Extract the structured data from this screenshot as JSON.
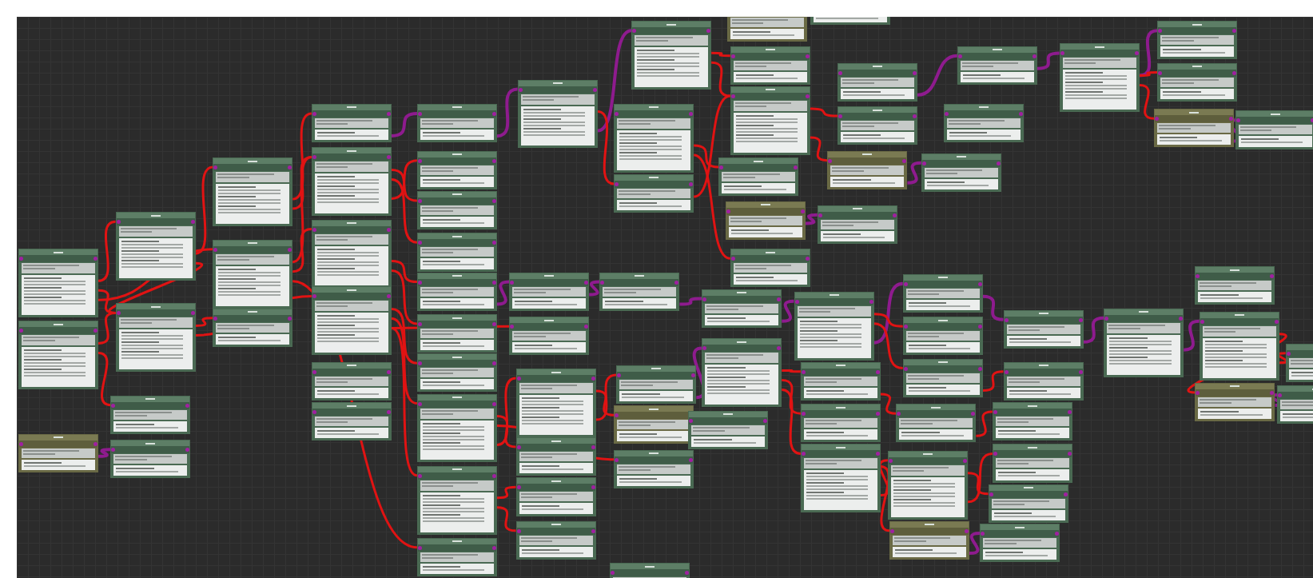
{
  "canvas": {
    "nodes": [
      {
        "kind": "chat",
        "expanded": true
      },
      {
        "kind": "chat",
        "expanded": true
      },
      {
        "kind": "event",
        "expanded": false
      },
      {
        "kind": "chat",
        "expanded": true
      },
      {
        "kind": "chat",
        "expanded": true
      },
      {
        "kind": "chat",
        "expanded": false
      },
      {
        "kind": "chat",
        "expanded": false
      },
      {
        "kind": "chat",
        "expanded": true
      },
      {
        "kind": "chat",
        "expanded": true
      },
      {
        "kind": "chat",
        "expanded": false
      },
      {
        "kind": "chat",
        "expanded": false
      },
      {
        "kind": "chat",
        "expanded": true
      },
      {
        "kind": "chat",
        "expanded": true
      },
      {
        "kind": "chat",
        "expanded": true
      },
      {
        "kind": "chat",
        "expanded": false
      },
      {
        "kind": "chat",
        "expanded": false
      },
      {
        "kind": "chat",
        "expanded": false
      },
      {
        "kind": "chat",
        "expanded": false
      },
      {
        "kind": "chat",
        "expanded": false
      },
      {
        "kind": "chat",
        "expanded": false
      },
      {
        "kind": "chat",
        "expanded": false
      },
      {
        "kind": "chat",
        "expanded": false
      },
      {
        "kind": "chat",
        "expanded": false
      },
      {
        "kind": "chat",
        "expanded": true
      },
      {
        "kind": "chat",
        "expanded": true
      },
      {
        "kind": "chat",
        "expanded": false
      },
      {
        "kind": "chat",
        "expanded": true
      },
      {
        "kind": "chat",
        "expanded": false
      },
      {
        "kind": "chat",
        "expanded": false
      },
      {
        "kind": "chat",
        "expanded": true
      },
      {
        "kind": "chat",
        "expanded": false
      },
      {
        "kind": "chat",
        "expanded": false
      },
      {
        "kind": "chat",
        "expanded": false
      },
      {
        "kind": "chat",
        "expanded": false
      },
      {
        "kind": "chat",
        "expanded": true
      },
      {
        "kind": "chat",
        "expanded": false
      },
      {
        "kind": "chat",
        "expanded": false
      },
      {
        "kind": "event",
        "expanded": false
      },
      {
        "kind": "chat",
        "expanded": false
      },
      {
        "kind": "chat"
      },
      {
        "kind": "chat",
        "expanded": true
      },
      {
        "kind": "chat",
        "expanded": false
      },
      {
        "kind": "chat",
        "expanded": true
      },
      {
        "kind": "chat",
        "expanded": false
      },
      {
        "kind": "event",
        "expanded": false
      },
      {
        "kind": "chat",
        "expanded": false
      },
      {
        "kind": "chat",
        "expanded": true
      },
      {
        "kind": "chat",
        "expanded": false
      },
      {
        "kind": "event",
        "expanded": false
      },
      {
        "kind": "chat",
        "expanded": false
      },
      {
        "kind": "chat",
        "expanded": false
      },
      {
        "kind": "chat",
        "expanded": false
      },
      {
        "kind": "chat",
        "expanded": false
      },
      {
        "kind": "chat",
        "expanded": true
      },
      {
        "kind": "chat",
        "expanded": false
      },
      {
        "kind": "chat",
        "expanded": false
      },
      {
        "kind": "chat",
        "expanded": true
      },
      {
        "kind": "event",
        "expanded": false
      },
      {
        "kind": "chat",
        "expanded": false
      },
      {
        "kind": "chat",
        "expanded": false
      },
      {
        "kind": "chat",
        "expanded": false
      },
      {
        "kind": "chat",
        "expanded": false
      },
      {
        "kind": "chat",
        "expanded": false
      },
      {
        "kind": "chat",
        "expanded": false
      },
      {
        "kind": "chat",
        "expanded": false
      },
      {
        "kind": "chat",
        "expanded": false
      },
      {
        "kind": "chat",
        "expanded": true
      },
      {
        "kind": "event",
        "expanded": false
      },
      {
        "kind": "chat",
        "expanded": false
      },
      {
        "kind": "chat",
        "expanded": false
      },
      {
        "kind": "chat",
        "expanded": false
      },
      {
        "kind": "chat",
        "expanded": false
      },
      {
        "kind": "chat",
        "expanded": false
      },
      {
        "kind": "chat",
        "expanded": false
      },
      {
        "kind": "chat",
        "expanded": true
      },
      {
        "kind": "chat",
        "expanded": true
      },
      {
        "kind": "chat",
        "expanded": false
      },
      {
        "kind": "chat",
        "expanded": false
      },
      {
        "kind": "event",
        "expanded": false
      },
      {
        "kind": "chat",
        "expanded": false
      },
      {
        "kind": "chat",
        "expanded": false
      },
      {
        "kind": "chat",
        "expanded": true
      },
      {
        "kind": "event",
        "expanded": false
      },
      {
        "kind": "chat",
        "expanded": false
      },
      {
        "kind": "chat",
        "expanded": false
      }
    ],
    "connections": [
      {
        "kind": "link"
      },
      {
        "kind": "link"
      },
      {
        "kind": "link"
      },
      {
        "kind": "link"
      },
      {
        "kind": "link"
      },
      {
        "kind": "link"
      },
      {
        "kind": "link"
      },
      {
        "kind": "link"
      },
      {
        "kind": "link"
      },
      {
        "kind": "link"
      },
      {
        "kind": "link"
      },
      {
        "kind": "link"
      },
      {
        "kind": "link"
      },
      {
        "kind": "link"
      },
      {
        "kind": "link"
      },
      {
        "kind": "link"
      },
      {
        "kind": "link"
      },
      {
        "kind": "link"
      },
      {
        "kind": "link"
      },
      {
        "kind": "link"
      },
      {
        "kind": "link"
      },
      {
        "kind": "choice"
      },
      {
        "kind": "choice"
      },
      {
        "kind": "choice"
      },
      {
        "kind": "choice"
      },
      {
        "kind": "choice"
      },
      {
        "kind": "choice"
      },
      {
        "kind": "choice"
      },
      {
        "kind": "choice"
      },
      {
        "kind": "choice"
      },
      {
        "kind": "choice"
      },
      {
        "kind": "choice"
      },
      {
        "kind": "choice"
      },
      {
        "kind": "choice"
      },
      {
        "kind": "choice"
      },
      {
        "kind": "choice"
      },
      {
        "kind": "choice"
      },
      {
        "kind": "choice"
      },
      {
        "kind": "choice"
      },
      {
        "kind": "choice"
      },
      {
        "kind": "choice"
      },
      {
        "kind": "choice"
      },
      {
        "kind": "choice"
      },
      {
        "kind": "choice"
      },
      {
        "kind": "choice"
      },
      {
        "kind": "choice"
      },
      {
        "kind": "choice"
      },
      {
        "kind": "choice"
      },
      {
        "kind": "choice"
      },
      {
        "kind": "choice"
      },
      {
        "kind": "choice"
      },
      {
        "kind": "choice"
      },
      {
        "kind": "choice"
      },
      {
        "kind": "choice"
      },
      {
        "kind": "choice"
      },
      {
        "kind": "choice"
      },
      {
        "kind": "choice"
      },
      {
        "kind": "choice"
      },
      {
        "kind": "choice"
      },
      {
        "kind": "choice"
      },
      {
        "kind": "choice"
      },
      {
        "kind": "choice"
      },
      {
        "kind": "choice"
      },
      {
        "kind": "choice"
      },
      {
        "kind": "choice"
      },
      {
        "kind": "choice"
      },
      {
        "kind": "choice"
      },
      {
        "kind": "choice"
      },
      {
        "kind": "choice"
      },
      {
        "kind": "choice"
      },
      {
        "kind": "choice"
      },
      {
        "kind": "choice"
      },
      {
        "kind": "choice"
      },
      {
        "kind": "choice"
      },
      {
        "kind": "choice"
      }
    ]
  }
}
